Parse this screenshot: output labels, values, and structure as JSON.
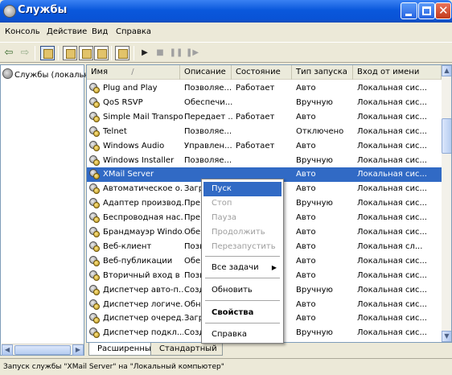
{
  "window": {
    "title": "Службы"
  },
  "menu": [
    "Консоль",
    "Действие",
    "Вид",
    "Справка"
  ],
  "toolbar": {
    "buttons": [
      "back-arrow",
      "forward-arrow",
      "console-tree",
      "properties",
      "refresh",
      "export-list",
      "help",
      "play",
      "stop",
      "pause",
      "restart"
    ]
  },
  "tree": {
    "root_label": "Службы (локальны"
  },
  "columns": [
    "Имя",
    "Описание",
    "Состояние",
    "Тип запуска",
    "Вход от имени"
  ],
  "sort_indicator": "/",
  "services": [
    {
      "name": "Plug and Play",
      "desc": "Позволяе...",
      "status": "Работает",
      "startup": "Авто",
      "logon": "Локальная сис..."
    },
    {
      "name": "QoS RSVP",
      "desc": "Обеспечи...",
      "status": "",
      "startup": "Вручную",
      "logon": "Локальная сис..."
    },
    {
      "name": "Simple Mail Transpo...",
      "desc": "Передает ...",
      "status": "Работает",
      "startup": "Авто",
      "logon": "Локальная сис..."
    },
    {
      "name": "Telnet",
      "desc": "Позволяе...",
      "status": "",
      "startup": "Отключено",
      "logon": "Локальная сис..."
    },
    {
      "name": "Windows Audio",
      "desc": "Управлен...",
      "status": "Работает",
      "startup": "Авто",
      "logon": "Локальная сис..."
    },
    {
      "name": "Windows Installer",
      "desc": "Позволяе...",
      "status": "",
      "startup": "Вручную",
      "logon": "Локальная сис..."
    },
    {
      "name": "XMail Server",
      "desc": "",
      "status": "",
      "startup": "Авто",
      "logon": "Локальная сис..."
    },
    {
      "name": "Автоматическое о...",
      "desc": "Загр",
      "status": "",
      "startup": "Авто",
      "logon": "Локальная сис..."
    },
    {
      "name": "Адаптер производ...",
      "desc": "Пре",
      "status": "",
      "startup": "Вручную",
      "logon": "Локальная сис..."
    },
    {
      "name": "Беспроводная нас...",
      "desc": "Пре",
      "status": "",
      "startup": "Авто",
      "logon": "Локальная сис..."
    },
    {
      "name": "Брандмауэр Windo...",
      "desc": "Обе",
      "status": "",
      "startup": "Авто",
      "logon": "Локальная сис..."
    },
    {
      "name": "Веб-клиент",
      "desc": "Позв",
      "status": "",
      "startup": "Авто",
      "logon": "Локальная сл..."
    },
    {
      "name": "Веб-публикации",
      "desc": "Обе",
      "status": "",
      "startup": "Авто",
      "logon": "Локальная сис..."
    },
    {
      "name": "Вторичный вход в ...",
      "desc": "Позв",
      "status": "",
      "startup": "Авто",
      "logon": "Локальная сис..."
    },
    {
      "name": "Диспетчер авто-п...",
      "desc": "Созд",
      "status": "",
      "startup": "Вручную",
      "logon": "Локальная сис..."
    },
    {
      "name": "Диспетчер логиче...",
      "desc": "Обн",
      "status": "",
      "startup": "Авто",
      "logon": "Локальная сис..."
    },
    {
      "name": "Диспетчер очеред...",
      "desc": "Загр",
      "status": "",
      "startup": "Авто",
      "logon": "Локальная сис..."
    },
    {
      "name": "Диспетчер подкл...",
      "desc": "Созд",
      "status": "",
      "startup": "Вручную",
      "logon": "Локальная сис..."
    }
  ],
  "selected_service_index": 6,
  "context_menu": {
    "items": [
      {
        "label": "Пуск",
        "state": "highlighted"
      },
      {
        "label": "Стоп",
        "state": "disabled"
      },
      {
        "label": "Пауза",
        "state": "disabled"
      },
      {
        "label": "Продолжить",
        "state": "disabled"
      },
      {
        "label": "Перезапустить",
        "state": "disabled"
      },
      {
        "label": "Все задачи",
        "state": "submenu"
      },
      {
        "label": "Обновить",
        "state": "normal"
      },
      {
        "label": "Свойства",
        "state": "bold"
      },
      {
        "label": "Справка",
        "state": "normal"
      }
    ]
  },
  "tabs": [
    {
      "label": "Расширенный",
      "active": true
    },
    {
      "label": "Стандартный",
      "active": false
    }
  ],
  "status_text": "Запуск службы \"XMail Server\" на \"Локальный компьютер\"",
  "colors": {
    "titlebar": "#0a58dc",
    "selection": "#316ac5",
    "window_bg": "#ece9d8"
  }
}
